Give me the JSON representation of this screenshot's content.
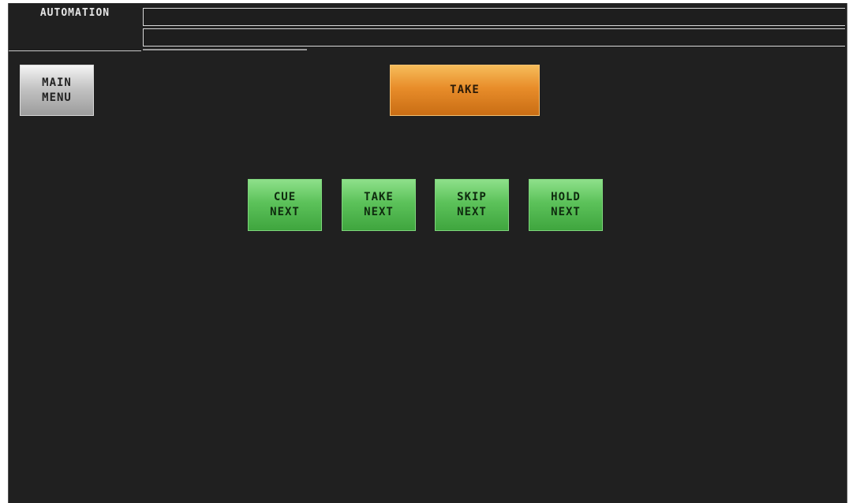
{
  "header": {
    "title": "AUTOMATION",
    "status_line_1": "",
    "status_line_2": ""
  },
  "buttons": {
    "main_menu": "MAIN\nMENU",
    "take": "TAKE",
    "cue_next": "CUE\nNEXT",
    "take_next": "TAKE\nNEXT",
    "skip_next": "SKIP\nNEXT",
    "hold_next": "HOLD\nNEXT"
  },
  "colors": {
    "background": "#202020",
    "menu_button": "#c4c4c4",
    "take_button": "#e88d2a",
    "next_buttons": "#5cc25a"
  }
}
